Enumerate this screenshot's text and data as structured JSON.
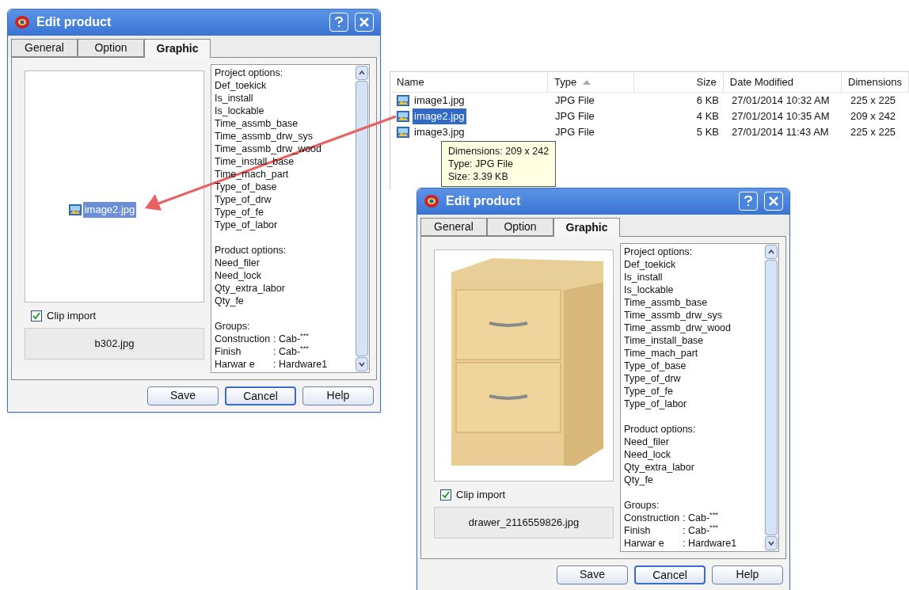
{
  "file_list": {
    "columns": [
      {
        "label": "Name",
        "sorted": false
      },
      {
        "label": "Type",
        "sorted": true
      },
      {
        "label": "Size",
        "sorted": false
      },
      {
        "label": "Date Modified",
        "sorted": false
      },
      {
        "label": "Dimensions",
        "sorted": false
      }
    ],
    "rows": [
      {
        "name": "image1.jpg",
        "type": "JPG File",
        "size": "6 KB",
        "date": "27/01/2014 10:32 AM",
        "dimensions": "225 x 225",
        "selected": false
      },
      {
        "name": "image2.jpg",
        "type": "JPG File",
        "size": "4 KB",
        "date": "27/01/2014 10:35 AM",
        "dimensions": "209 x 242",
        "selected": true
      },
      {
        "name": "image3.jpg",
        "type": "JPG File",
        "size": "5 KB",
        "date": "27/01/2014 11:43 AM",
        "dimensions": "225 x 225",
        "selected": false
      }
    ],
    "tooltip": [
      "Dimensions: 209 x 242",
      "Type: JPG File",
      "Size: 3.39 KB"
    ]
  },
  "dialogs": [
    {
      "title": "Edit product",
      "tabs": [
        {
          "label": "General",
          "selected": false
        },
        {
          "label": "Option",
          "selected": false
        },
        {
          "label": "Graphic",
          "selected": true
        }
      ],
      "preview": {
        "kind": "dropped-file",
        "label": "image2.jpg"
      },
      "clip_import": {
        "label": "Clip import",
        "checked": true
      },
      "filename": "b302.jpg",
      "options": [
        {
          "heading": "Project options:",
          "items": [
            "Def_toekick",
            "Is_install",
            "Is_lockable",
            "Time_assmb_base",
            "Time_assmb_drw_sys",
            "Time_assmb_drw_wood",
            "Time_install_base",
            "Time_mach_part",
            "Type_of_base",
            "Type_of_drw",
            "Type_of_fe",
            "Type_of_labor"
          ]
        },
        {
          "heading": "Product options:",
          "items": [
            "Need_filer",
            "Need_lock",
            "Qty_extra_labor",
            "Qty_fe"
          ]
        }
      ],
      "groups": {
        "heading": "Groups:",
        "items": [
          {
            "name": "Construction",
            "value": ": Cab-$^{***}$"
          },
          {
            "name": "Finish",
            "value": ": Cab-$^{***}$"
          },
          {
            "name": "Harwar e",
            "value": ": Hardware1"
          }
        ]
      },
      "buttons": [
        {
          "label": "Save",
          "default": false
        },
        {
          "label": "Cancel",
          "default": true
        },
        {
          "label": "Help",
          "default": false
        }
      ]
    },
    {
      "title": "Edit product",
      "tabs": [
        {
          "label": "General",
          "selected": false
        },
        {
          "label": "Option",
          "selected": false
        },
        {
          "label": "Graphic",
          "selected": true
        }
      ],
      "preview": {
        "kind": "photo"
      },
      "clip_import": {
        "label": "Clip import",
        "checked": true
      },
      "filename": "drawer_2116559826.jpg",
      "options": [
        {
          "heading": "Project options:",
          "items": [
            "Def_toekick",
            "Is_install",
            "Is_lockable",
            "Time_assmb_base",
            "Time_assmb_drw_sys",
            "Time_assmb_drw_wood",
            "Time_install_base",
            "Time_mach_part",
            "Type_of_base",
            "Type_of_drw",
            "Type_of_fe",
            "Type_of_labor"
          ]
        },
        {
          "heading": "Product options:",
          "items": [
            "Need_filer",
            "Need_lock",
            "Qty_extra_labor",
            "Qty_fe"
          ]
        }
      ],
      "groups": {
        "heading": "Groups:",
        "items": [
          {
            "name": "Construction",
            "value": ": Cab-$^{***}$"
          },
          {
            "name": "Finish",
            "value": ": Cab-$^{***}$"
          },
          {
            "name": "Harwar e",
            "value": ": Hardware1"
          }
        ]
      },
      "buttons": [
        {
          "label": "Save",
          "default": false
        },
        {
          "label": "Cancel",
          "default": true
        },
        {
          "label": "Help",
          "default": false
        }
      ]
    }
  ]
}
